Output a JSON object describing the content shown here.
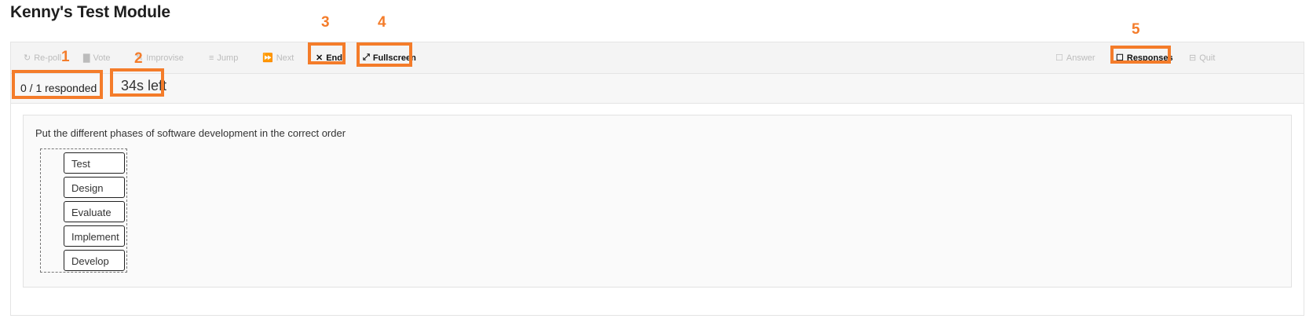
{
  "page": {
    "title": "Kenny's Test Module"
  },
  "toolbar": {
    "left": [
      {
        "name": "repoll",
        "icon": "refresh-icon",
        "label": "Re-poll",
        "enabled": false
      },
      {
        "name": "vote",
        "icon": "bar-chart-icon",
        "label": "Vote",
        "enabled": false
      },
      {
        "name": "improvise",
        "icon": "pencil-icon",
        "label": "Improvise",
        "enabled": false
      },
      {
        "name": "jump",
        "icon": "list-icon",
        "label": "Jump",
        "enabled": false
      },
      {
        "name": "next",
        "icon": "fast-forward-icon",
        "label": "Next",
        "enabled": false
      },
      {
        "name": "end",
        "icon": "close-icon",
        "label": "End",
        "enabled": true
      },
      {
        "name": "fullscreen",
        "icon": "expand-icon",
        "label": "Fullscreen",
        "enabled": true
      }
    ],
    "right": [
      {
        "name": "answer",
        "icon": "checkbox-icon",
        "label": "Answer",
        "enabled": false
      },
      {
        "name": "responses",
        "icon": "checkbox-icon",
        "label": "Responses",
        "enabled": true
      },
      {
        "name": "quit",
        "icon": "close-box-icon",
        "label": "Quit",
        "enabled": false
      }
    ]
  },
  "annotations": {
    "n1": "1",
    "n2": "2",
    "n3": "3",
    "n4": "4",
    "n5": "5",
    "color": "#f47c2a"
  },
  "status": {
    "responded": "0 / 1 responded",
    "time_left": "34s left"
  },
  "question": {
    "text": "Put the different phases of software development in the correct order",
    "items": [
      "Test",
      "Design",
      "Evaluate",
      "Implement",
      "Develop"
    ]
  }
}
